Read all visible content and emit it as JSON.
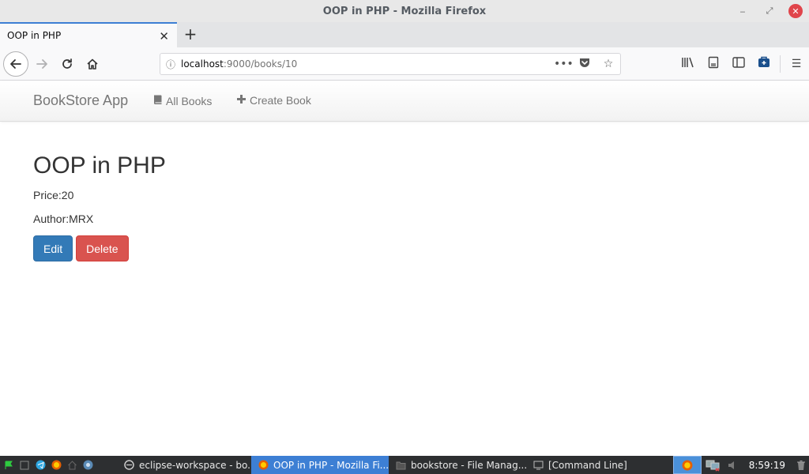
{
  "window": {
    "title": "OOP in PHP - Mozilla Firefox",
    "controls": {
      "minimize": "‒",
      "maximize": "⤢",
      "close": "✕"
    }
  },
  "tabs": [
    {
      "label": "OOP in PHP",
      "active": true
    }
  ],
  "tab_close": "✕",
  "new_tab": "+",
  "nav": {
    "url_host": "localhost",
    "url_path": ":9000/books/10",
    "icons": [
      "back-icon",
      "forward-icon",
      "reload-icon",
      "home-icon",
      "info-icon",
      "more-icon",
      "pocket-icon",
      "star-icon",
      "library-icon",
      "reader-icon",
      "sidebar-icon",
      "extension-icon",
      "menu-icon"
    ]
  },
  "site": {
    "brand": "BookStore App",
    "links": [
      {
        "label": "All Books",
        "icon": "book-icon"
      },
      {
        "label": "Create Book",
        "icon": "plus-icon"
      }
    ]
  },
  "book": {
    "title": "OOP in PHP",
    "price": "Price:20",
    "author": "Author:MRX",
    "edit_label": "Edit",
    "delete_label": "Delete"
  },
  "taskbar": {
    "tasks": [
      {
        "label": "eclipse-workspace - bo...",
        "icon": "eclipse-icon",
        "active": false
      },
      {
        "label": "OOP in PHP - Mozilla Fi...",
        "icon": "firefox-icon",
        "active": true
      },
      {
        "label": "bookstore - File Manag...",
        "icon": "folder-icon",
        "active": false
      },
      {
        "label": "[Command Line]",
        "icon": "terminal-icon",
        "active": false
      }
    ],
    "clock": "8:59:19"
  },
  "colors": {
    "accent": "#3d7fd4",
    "edit_button": "#337ab7",
    "delete_button": "#d9534f",
    "taskbar": "#2d2f31"
  }
}
